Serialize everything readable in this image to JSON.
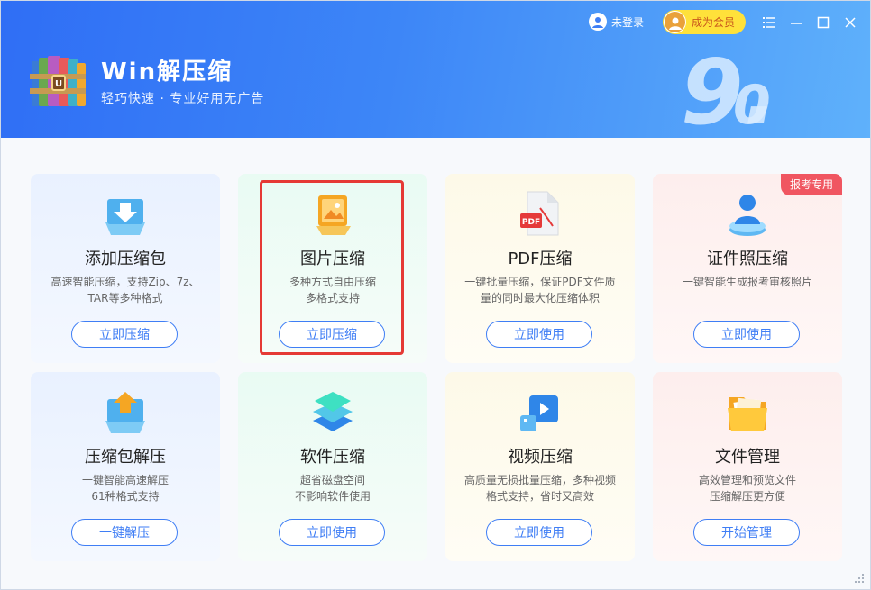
{
  "header": {
    "app_title": "Win解压缩",
    "app_subtitle": "轻巧快速 · 专业好用无广告",
    "version": "9.0",
    "login_label": "未登录",
    "vip_label": "成为会员",
    "controls": [
      "menu-icon",
      "minimize-icon",
      "maximize-icon",
      "close-icon"
    ]
  },
  "colors": {
    "header_gradient": [
      "#2f6ef5",
      "#5fb1fb"
    ],
    "accent": "#3f7ef5",
    "vip": "#ffe13a",
    "tag": "#f05661",
    "highlight": "#e53935"
  },
  "cards": [
    {
      "title": "添加压缩包",
      "desc1": "高速智能压缩，支持Zip、7z、",
      "desc2": "TAR等多种格式",
      "button": "立即压缩",
      "icon": "add-archive-icon"
    },
    {
      "title": "图片压缩",
      "desc1": "多种方式自由压缩",
      "desc2": "多格式支持",
      "button": "立即压缩",
      "icon": "image-compress-icon"
    },
    {
      "title": "PDF压缩",
      "desc1": "一键批量压缩，保证PDF文件质",
      "desc2": "量的同时最大化压缩体积",
      "button": "立即使用",
      "icon": "pdf-icon"
    },
    {
      "title": "证件照压缩",
      "desc1": "一键智能生成报考审核照片",
      "desc2": "",
      "button": "立即使用",
      "icon": "id-photo-icon",
      "tag": "报考专用"
    },
    {
      "title": "压缩包解压",
      "desc1": "一键智能高速解压",
      "desc2": "61种格式支持",
      "button": "一键解压",
      "icon": "extract-archive-icon"
    },
    {
      "title": "软件压缩",
      "desc1": "超省磁盘空间",
      "desc2": "不影响软件使用",
      "button": "立即使用",
      "icon": "software-compress-icon"
    },
    {
      "title": "视频压缩",
      "desc1": "高质量无损批量压缩，多种视频",
      "desc2": "格式支持，省时又高效",
      "button": "立即使用",
      "icon": "video-compress-icon"
    },
    {
      "title": "文件管理",
      "desc1": "高效管理和预览文件",
      "desc2": "压缩解压更方便",
      "button": "开始管理",
      "icon": "folder-icon"
    }
  ]
}
